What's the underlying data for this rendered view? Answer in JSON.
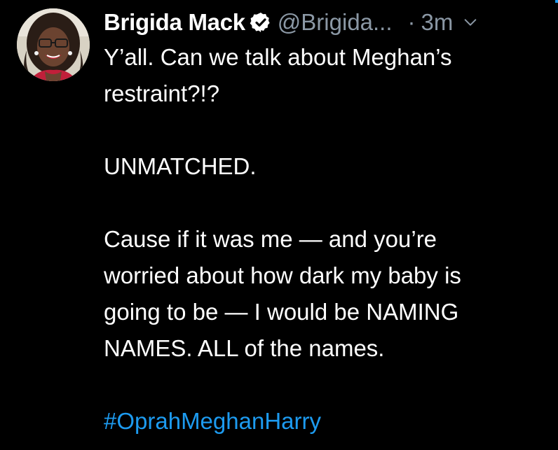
{
  "author": {
    "name": "Brigida Mack",
    "handle": "@Brigida...",
    "separator": "·",
    "time": "3m"
  },
  "icons": {
    "verified": "verified-badge-icon",
    "more": "chevron-down-icon"
  },
  "colors": {
    "background": "#000000",
    "text": "#ffffff",
    "secondary": "#8b98a5",
    "link": "#1d9bf0"
  },
  "tweet": {
    "line1": "Y’all. Can we talk about Meghan’s",
    "line2": "restraint?!?",
    "para2": "UNMATCHED.",
    "para3_line1": "Cause if it was me — and you’re",
    "para3_line2": "worried about how dark my baby is",
    "para3_line3": "going to be — I would be NAMING",
    "para3_line4": "NAMES. ALL of the names.",
    "hashtag": "#OprahMeghanHarry"
  }
}
